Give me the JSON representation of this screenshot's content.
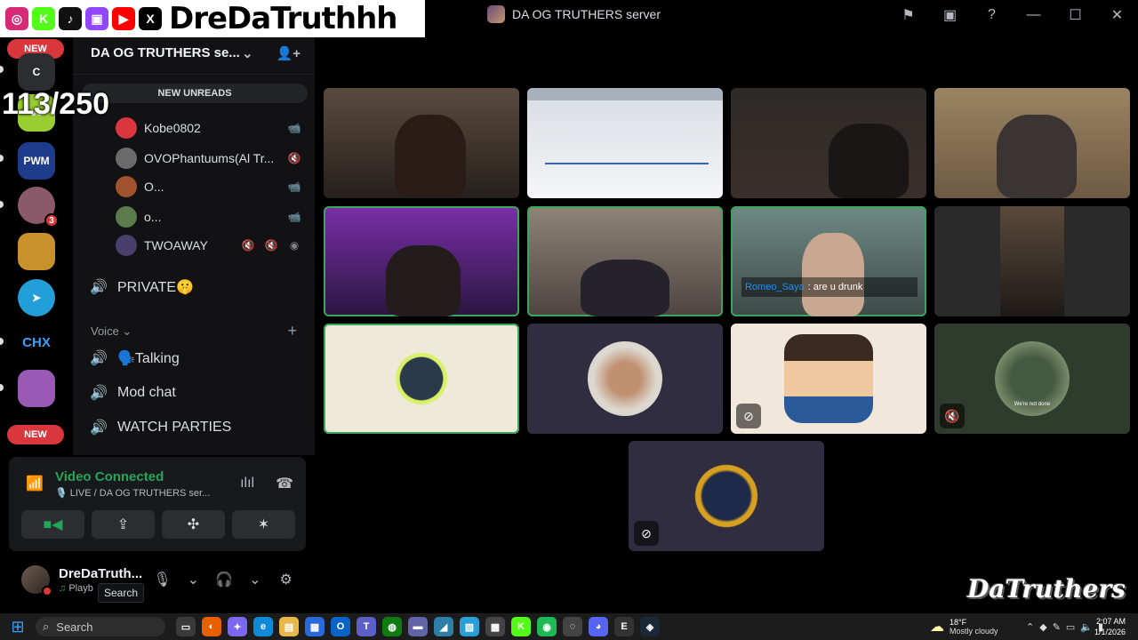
{
  "overlay": {
    "socials": [
      {
        "name": "instagram-icon",
        "glyph": "◎",
        "color": "#d62976"
      },
      {
        "name": "kick-icon",
        "glyph": "K",
        "color": "#53fc18"
      },
      {
        "name": "tiktok-icon",
        "glyph": "♪",
        "color": "#111111"
      },
      {
        "name": "twitch-icon",
        "glyph": "▣",
        "color": "#9146ff"
      },
      {
        "name": "youtube-icon",
        "glyph": "▶",
        "color": "#ff0000"
      },
      {
        "name": "x-icon",
        "glyph": "X",
        "color": "#000000"
      }
    ],
    "streamer_name": "DreDaTruthhh",
    "follower_goal": "113/250",
    "watermark": "DaTruthers"
  },
  "titlebar": {
    "title": "DA OG TRUTHERS server",
    "icons": [
      "inbox-flag-icon",
      "window-icon",
      "help-icon"
    ],
    "controls": [
      "minimize-icon",
      "maximize-icon",
      "close-icon"
    ]
  },
  "rail": {
    "new_label": "NEW",
    "dm_badge": "3",
    "servers": [
      {
        "name": "server-c",
        "label": "C",
        "color": "#2b2d31"
      },
      {
        "name": "server-green",
        "label": "●●",
        "color": "#9acd32"
      },
      {
        "name": "server-pwm",
        "label": "PWM",
        "color": "#1f3c8c"
      },
      {
        "name": "server-girl",
        "label": "",
        "color": "#8a5a6a"
      },
      {
        "name": "server-king",
        "label": "",
        "color": "#c8912c"
      },
      {
        "name": "server-telegram",
        "label": "➤",
        "color": "#229ed9"
      },
      {
        "name": "server-chx",
        "label": "CHX",
        "color": "#000000"
      },
      {
        "name": "server-purple",
        "label": "",
        "color": "#9b59b6"
      }
    ]
  },
  "sidebar": {
    "server_name": "DA OG TRUTHERS se...",
    "new_unreads": "NEW UNREADS",
    "voice_users": [
      {
        "name": "Kobe0802",
        "color": "#da373c",
        "icons": [
          "📹"
        ]
      },
      {
        "name": "OVOPhantuums(Al Tr...",
        "color": "#6b6b6b",
        "icons": [
          "🔇"
        ]
      },
      {
        "name": "O...",
        "color": "#a0522d",
        "icons": [
          "📹"
        ]
      },
      {
        "name": "o...",
        "color": "#5b7c4a",
        "icons": [
          "📹"
        ]
      },
      {
        "name": "TWOAWAY",
        "color": "#4a3f6b",
        "icons": [
          "🔇",
          "🔇",
          "◉"
        ]
      }
    ],
    "channels": [
      {
        "label": "PRIVATE🤫",
        "bright": true
      },
      {
        "label": "🗣️Talking",
        "bright": true
      },
      {
        "label": "Mod chat",
        "bright": true
      },
      {
        "label": "WATCH PARTIES",
        "bright": true
      }
    ],
    "category": "Voice"
  },
  "voice_panel": {
    "status": "Video Connected",
    "subtitle": "🎙️ LIVE / DA OG TRUTHERS ser...",
    "buttons": [
      "camera-icon",
      "screen-share-icon",
      "activities-icon",
      "soundboard-icon"
    ],
    "status_color": "#23a55a"
  },
  "user_panel": {
    "name": "DreDaTruth...",
    "activity": "Playb",
    "activity_tail": "1",
    "tooltip": "Search"
  },
  "stage": {
    "caption_prefix": "Romeo_Saya",
    "caption_text": ": are u drunk",
    "avatar_caption": "We're not done"
  },
  "taskbar": {
    "search_placeholder": "Search",
    "apps": [
      {
        "name": "task-view-icon",
        "glyph": "▭",
        "color": "#3a3a3a"
      },
      {
        "name": "firefox-icon",
        "glyph": "◐",
        "color": "#e66000"
      },
      {
        "name": "copilot-icon",
        "glyph": "✦",
        "color": "#7b68ee"
      },
      {
        "name": "edge-icon",
        "glyph": "e",
        "color": "#0f8ad8"
      },
      {
        "name": "explorer-icon",
        "glyph": "▤",
        "color": "#e8b84a"
      },
      {
        "name": "store-icon",
        "glyph": "▦",
        "color": "#2a6ad8"
      },
      {
        "name": "outlook-icon",
        "glyph": "O",
        "color": "#0a64c8"
      },
      {
        "name": "teams-icon",
        "glyph": "T",
        "color": "#5b5fc7"
      },
      {
        "name": "xbox-icon",
        "glyph": "◍",
        "color": "#107c10"
      },
      {
        "name": "notes-icon",
        "glyph": "▬",
        "color": "#6264a7"
      },
      {
        "name": "hdd-icon",
        "glyph": "◢",
        "color": "#2d7fa8"
      },
      {
        "name": "photos-icon",
        "glyph": "▧",
        "color": "#2a9fd6"
      },
      {
        "name": "terminal-icon",
        "glyph": "▩",
        "color": "#444444"
      },
      {
        "name": "kick-app-icon",
        "glyph": "K",
        "color": "#53fc18"
      },
      {
        "name": "spotify-icon",
        "glyph": "◉",
        "color": "#1db954"
      },
      {
        "name": "obs-icon",
        "glyph": "◌",
        "color": "#444444"
      },
      {
        "name": "discord-icon",
        "glyph": "◕",
        "color": "#5865f2"
      },
      {
        "name": "epic-icon",
        "glyph": "E",
        "color": "#333333"
      },
      {
        "name": "steam-icon",
        "glyph": "◈",
        "color": "#1b2838"
      }
    ],
    "weather_temp": "18°F",
    "weather_desc": "Mostly cloudy",
    "time": "2:07 AM",
    "date": "1/1/2026"
  }
}
